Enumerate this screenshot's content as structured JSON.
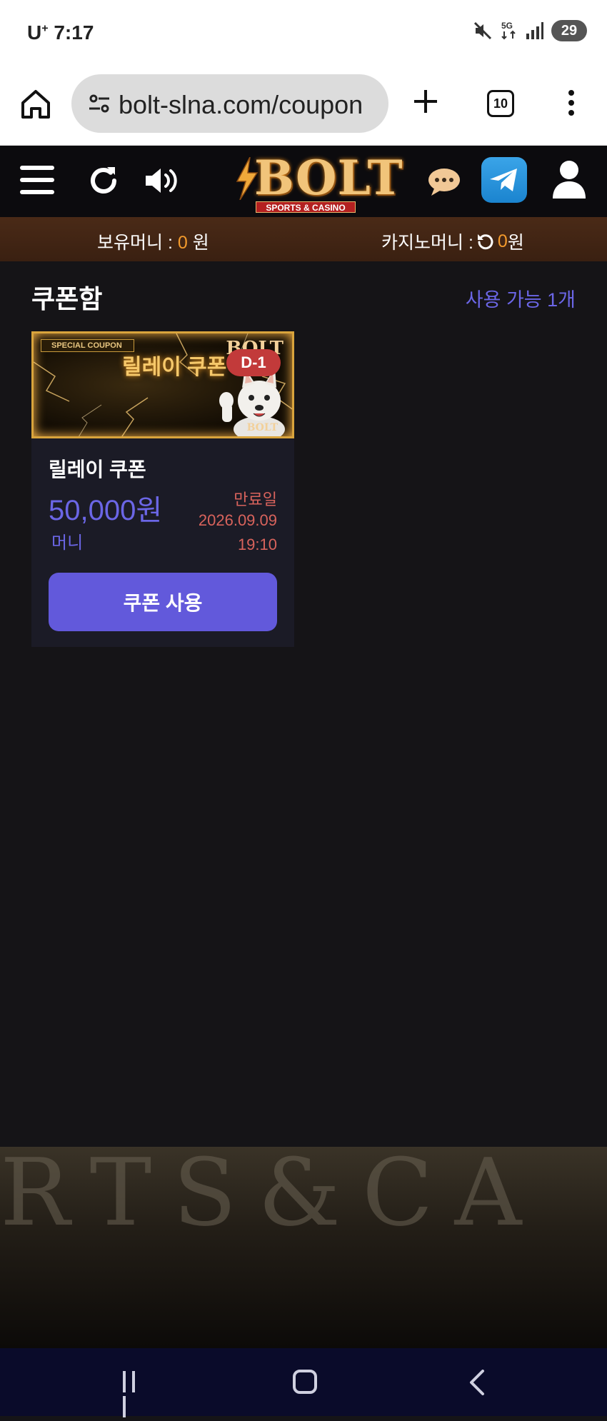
{
  "status_bar": {
    "carrier": "U",
    "carrier_sup": "+",
    "time": "7:17",
    "battery": "29",
    "icons": [
      "mute-icon",
      "5g-icon",
      "signal-icon",
      "battery-icon"
    ]
  },
  "browser": {
    "url": "bolt-slna.com/coupon",
    "tab_count": "10",
    "icons": [
      "home-icon",
      "site-settings-icon",
      "plus-icon",
      "tabs-icon",
      "more-icon"
    ]
  },
  "header": {
    "logo_text": "BOLT",
    "logo_sub": "SPORTS & CASINO",
    "icons": [
      "menu-icon",
      "refresh-icon",
      "speaker-icon",
      "chat-icon",
      "telegram-icon",
      "user-icon"
    ]
  },
  "money_bar": {
    "held_label": "보유머니 : ",
    "held_amount": "0",
    "held_unit": " 원",
    "casino_label": "카지노머니 : ",
    "casino_amount": "0",
    "casino_unit": " 원"
  },
  "page": {
    "title": "쿠폰함",
    "available": "사용 가능 1개"
  },
  "coupon": {
    "banner_tag": "SPECIAL COUPON",
    "banner_title": "릴레이 쿠폰",
    "banner_brand": "BOLT",
    "banner_brand_small": "BOLT",
    "dday": "D-1",
    "name": "릴레이 쿠폰",
    "amount": "50,000원",
    "type": "머니",
    "expiry_label": "만료일",
    "expiry_date": "2026.09.09",
    "expiry_time": "19:10",
    "button_label": "쿠폰 사용"
  },
  "footer": {
    "decor_text": "RTS&CA"
  },
  "colors": {
    "accent": "#6259db",
    "accent_text": "#6b66e6",
    "money_amount": "#f39a2c",
    "expiry": "#d8635c",
    "background": "#151417",
    "money_bar": "#4a2a17"
  }
}
